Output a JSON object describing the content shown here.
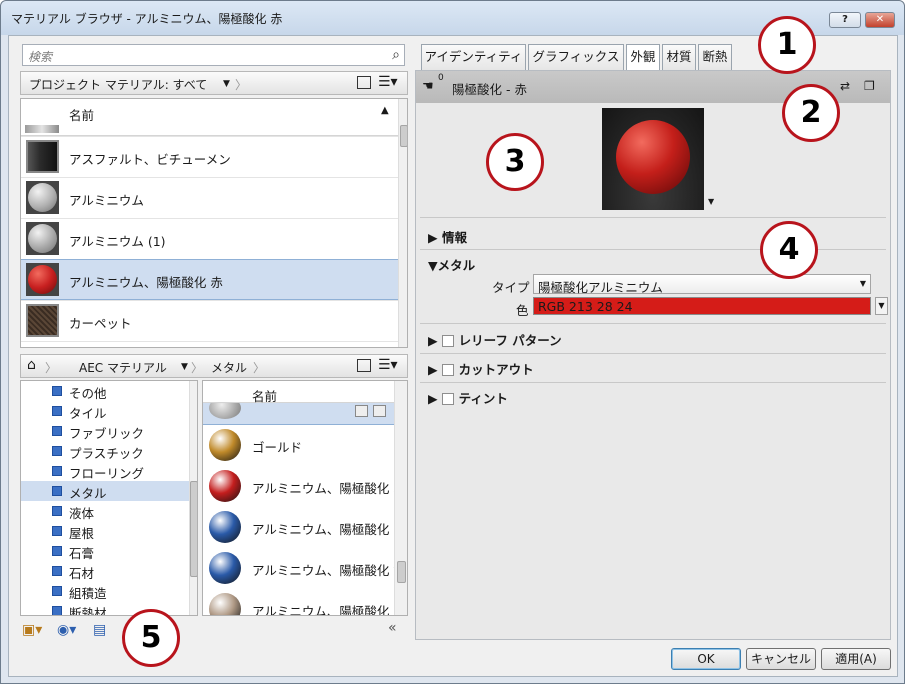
{
  "window": {
    "title": "マテリアル ブラウザ - アルミニウム、陽極酸化 赤",
    "help_label": "?",
    "close_label": "✕"
  },
  "search": {
    "placeholder": "検索"
  },
  "project": {
    "breadcrumb": "プロジェクト マテリアル: すべて",
    "column_name": "名前",
    "items": [
      {
        "label": "アスファルト、ビチューメン",
        "icon": "asphalt-thumb",
        "color": "#2c2c2c"
      },
      {
        "label": "アルミニウム",
        "icon": "aluminum-thumb",
        "color": "#b0b0b0"
      },
      {
        "label": "アルミニウム (1)",
        "icon": "aluminum-thumb",
        "color": "#a8a8a8"
      },
      {
        "label": "アルミニウム、陽極酸化 赤",
        "icon": "red-sphere-thumb",
        "color": "#c82020",
        "selected": true
      },
      {
        "label": "カーペット",
        "icon": "carpet-thumb",
        "color": "#5a4636"
      }
    ]
  },
  "library": {
    "home": "home-icon",
    "crumb1": "AEC マテリアル",
    "crumb2": "メタル",
    "column_name": "名前",
    "categories": [
      "その他",
      "タイル",
      "ファブリック",
      "プラスチック",
      "フローリング",
      "メタル",
      "液体",
      "屋根",
      "石膏",
      "石材",
      "組積造",
      "断熱材"
    ],
    "selected_category": "メタル",
    "materials": [
      {
        "label": "ゴールド",
        "color": "#c08a2a"
      },
      {
        "label": "アルミニウム、陽極酸化 赤",
        "color": "#c41e1e"
      },
      {
        "label": "アルミニウム、陽極酸化 青",
        "color": "#2a5aa8"
      },
      {
        "label": "アルミニウム、陽極酸化 銀",
        "color": "#2a5aa8"
      },
      {
        "label": "アルミニウム、陽極酸化 フ",
        "color": "#b09a86"
      }
    ]
  },
  "tabs": [
    "アイデンティティ",
    "グラフィックス",
    "外観",
    "材質",
    "断熱"
  ],
  "active_tab": "外観",
  "asset": {
    "count": "0",
    "name": "陽極酸化 - 赤"
  },
  "sections": {
    "info": "情報",
    "metal": "メタル",
    "type_label": "タイプ",
    "type_value": "陽極酸化アルミニウム",
    "color_label": "色",
    "color_value": "RGB 213 28 24",
    "color_hex": "#d51c18",
    "relief": "レリーフ パターン",
    "cutout": "カットアウト",
    "tint": "ティント"
  },
  "buttons": {
    "ok": "OK",
    "cancel": "キャンセル",
    "apply": "適用(A)"
  },
  "callouts": [
    "1",
    "2",
    "3",
    "4",
    "5"
  ]
}
